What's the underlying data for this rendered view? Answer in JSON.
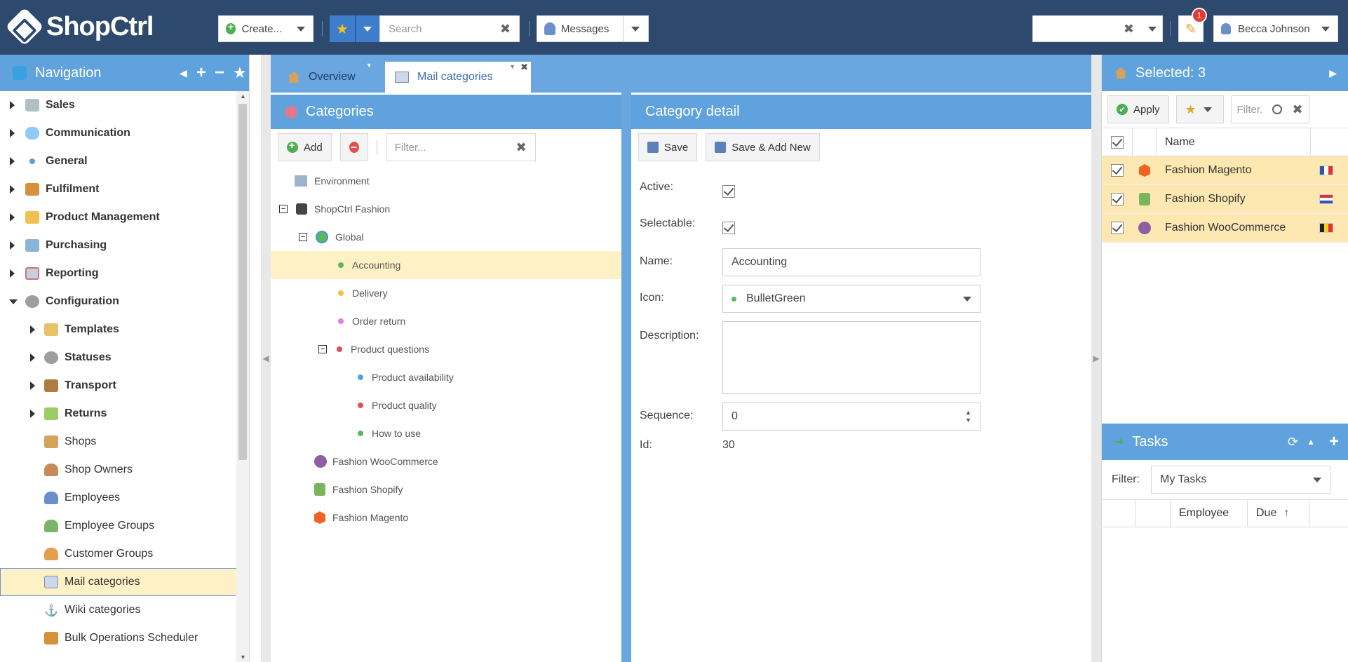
{
  "app": {
    "logo": "ShopCtrl"
  },
  "topbar": {
    "create_label": "Create...",
    "search_placeholder": "Search",
    "messages_label": "Messages",
    "notification_count": "1",
    "user_name": "Becca Johnson"
  },
  "nav": {
    "title": "Navigation",
    "items": [
      {
        "label": "Sales",
        "bold": true
      },
      {
        "label": "Communication",
        "bold": true
      },
      {
        "label": "General",
        "bold": true
      },
      {
        "label": "Fulfilment",
        "bold": true
      },
      {
        "label": "Product Management",
        "bold": true
      },
      {
        "label": "Purchasing",
        "bold": true
      },
      {
        "label": "Reporting",
        "bold": true
      },
      {
        "label": "Configuration",
        "bold": true
      },
      {
        "label": "Templates",
        "bold": true
      },
      {
        "label": "Statuses",
        "bold": true
      },
      {
        "label": "Transport",
        "bold": true
      },
      {
        "label": "Returns",
        "bold": true
      },
      {
        "label": "Shops"
      },
      {
        "label": "Shop Owners"
      },
      {
        "label": "Employees"
      },
      {
        "label": "Employee Groups"
      },
      {
        "label": "Customer Groups"
      },
      {
        "label": "Mail categories",
        "selected": true
      },
      {
        "label": "Wiki categories"
      },
      {
        "label": "Bulk Operations Scheduler"
      }
    ]
  },
  "tabs": [
    {
      "label": "Overview"
    },
    {
      "label": "Mail categories",
      "active": true
    }
  ],
  "categories": {
    "title": "Categories",
    "add_label": "Add",
    "filter_placeholder": "Filter...",
    "tree": [
      {
        "label": "Environment"
      },
      {
        "label": "ShopCtrl Fashion"
      },
      {
        "label": "Global"
      },
      {
        "label": "Accounting",
        "color": "#5cb85c",
        "selected": true
      },
      {
        "label": "Delivery",
        "color": "#f0c040"
      },
      {
        "label": "Order return",
        "color": "#e080e0"
      },
      {
        "label": "Product questions",
        "color": "#e05050"
      },
      {
        "label": "Product availability",
        "color": "#5aa0e0"
      },
      {
        "label": "Product quality",
        "color": "#e05050"
      },
      {
        "label": "How to use",
        "color": "#5cb85c"
      },
      {
        "label": "Fashion WooCommerce"
      },
      {
        "label": "Fashion Shopify"
      },
      {
        "label": "Fashion Magento"
      }
    ]
  },
  "detail": {
    "title": "Category detail",
    "save_label": "Save",
    "save_new_label": "Save & Add New",
    "labels": {
      "active": "Active:",
      "selectable": "Selectable:",
      "name": "Name:",
      "icon": "Icon:",
      "description": "Description:",
      "sequence": "Sequence:",
      "id": "Id:"
    },
    "values": {
      "name": "Accounting",
      "icon": "BulletGreen",
      "description": "",
      "sequence": "0",
      "id": "30"
    }
  },
  "selected": {
    "title": "Selected: 3",
    "apply_label": "Apply",
    "filter_placeholder": "Filter.",
    "col_name": "Name",
    "rows": [
      {
        "name": "Fashion Magento",
        "flag": "fr"
      },
      {
        "name": "Fashion Shopify",
        "flag": "nl"
      },
      {
        "name": "Fashion WooCommerce",
        "flag": "be"
      }
    ]
  },
  "tasks": {
    "title": "Tasks",
    "filter_label": "Filter:",
    "filter_value": "My Tasks",
    "col_employee": "Employee",
    "col_due": "Due"
  }
}
